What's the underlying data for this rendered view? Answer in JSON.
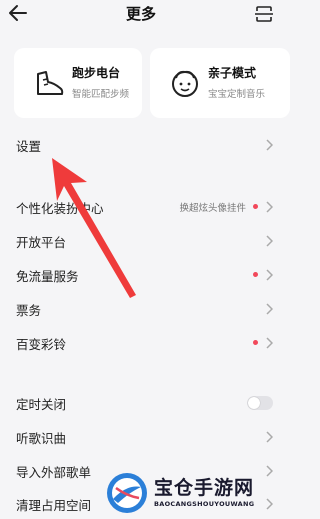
{
  "header": {
    "title": "更多",
    "back_icon": "back-arrow-icon",
    "right_icon": "scan-icon"
  },
  "cards": [
    {
      "title": "跑步电台",
      "subtitle": "智能匹配步频",
      "icon": "running-shoe-icon"
    },
    {
      "title": "亲子模式",
      "subtitle": "宝宝定制音乐",
      "icon": "child-face-icon"
    }
  ],
  "menu": {
    "settings": {
      "label": "设置"
    },
    "personalize": {
      "label": "个性化装扮中心",
      "extra": "换超炫头像挂件",
      "badge": true
    },
    "open_platform": {
      "label": "开放平台"
    },
    "free_data": {
      "label": "免流量服务",
      "badge": true
    },
    "tickets": {
      "label": "票务"
    },
    "ringtone": {
      "label": "百变彩铃",
      "badge": true
    },
    "sleep_timer": {
      "label": "定时关闭",
      "toggle_on": false
    },
    "song_recognition": {
      "label": "听歌识曲"
    },
    "import_playlist": {
      "label": "导入外部歌单"
    },
    "clear_cache": {
      "label": "清理占用空间"
    }
  },
  "watermark": {
    "title": "宝仓手游网",
    "subtitle": "BAOCANGSHOUYOUWANG"
  },
  "colors": {
    "accent_red": "#f2485b",
    "arrow_red": "#ef3b3b",
    "background": "#f5f5f7"
  }
}
